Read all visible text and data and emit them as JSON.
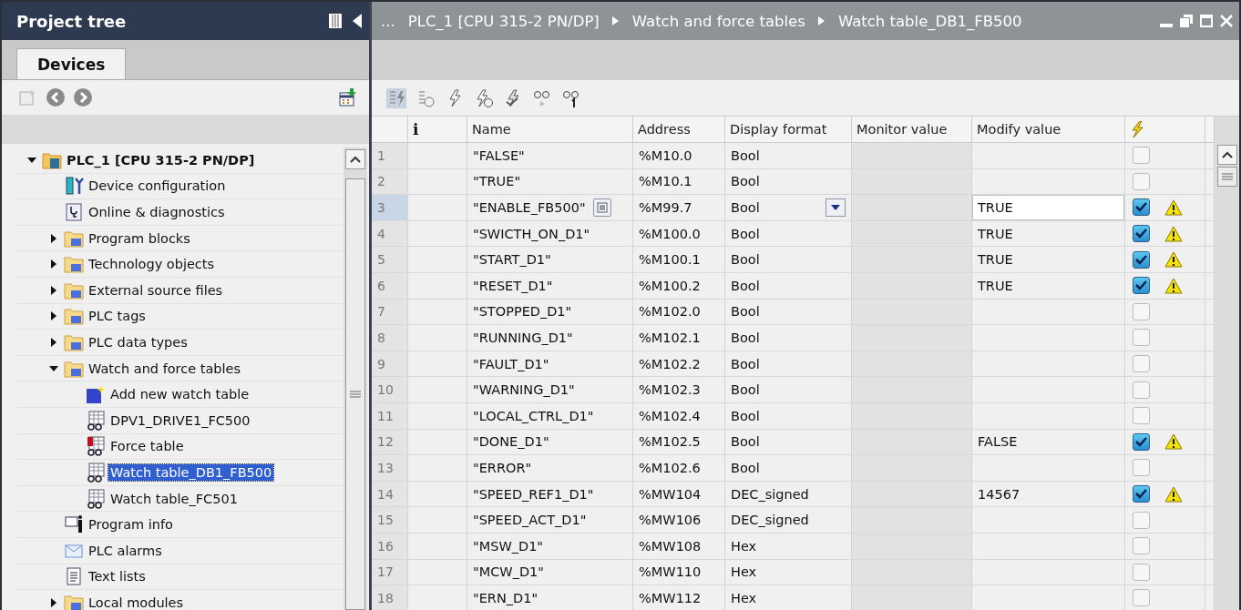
{
  "project_tree": {
    "title": "Project tree",
    "tabs": [
      {
        "label": "Devices",
        "selected": true
      }
    ],
    "items": [
      {
        "label": "PLC_1 [CPU 315-2 PN/DP]",
        "kind": "plc",
        "expanded": true,
        "selected": false,
        "children": [
          {
            "label": "Device configuration",
            "kind": "config",
            "selected": false
          },
          {
            "label": "Online & diagnostics",
            "kind": "diag",
            "selected": false
          },
          {
            "label": "Program blocks",
            "kind": "folder",
            "expanded": false,
            "selected": false
          },
          {
            "label": "Technology objects",
            "kind": "folder",
            "expanded": false,
            "selected": false
          },
          {
            "label": "External source files",
            "kind": "folder",
            "expanded": false,
            "selected": false
          },
          {
            "label": "PLC tags",
            "kind": "folder",
            "expanded": false,
            "selected": false
          },
          {
            "label": "PLC data types",
            "kind": "folder",
            "expanded": false,
            "selected": false
          },
          {
            "label": "Watch and force tables",
            "kind": "folder",
            "expanded": true,
            "selected": false,
            "children": [
              {
                "label": "Add new watch table",
                "kind": "add",
                "selected": false
              },
              {
                "label": "DPV1_DRIVE1_FC500",
                "kind": "table",
                "selected": false
              },
              {
                "label": "Force table",
                "kind": "force",
                "selected": false
              },
              {
                "label": "Watch table_DB1_FB500",
                "kind": "table",
                "selected": true
              },
              {
                "label": "Watch table_FC501",
                "kind": "table",
                "selected": false
              }
            ]
          },
          {
            "label": "Program info",
            "kind": "info",
            "selected": false
          },
          {
            "label": "PLC alarms",
            "kind": "mail",
            "selected": false
          },
          {
            "label": "Text lists",
            "kind": "text",
            "selected": false
          },
          {
            "label": "Local modules",
            "kind": "folder",
            "expanded": false,
            "selected": false
          }
        ]
      }
    ]
  },
  "editor": {
    "breadcrumb": [
      "...",
      "PLC_1 [CPU 315-2 PN/DP]",
      "Watch and force tables",
      "Watch table_DB1_FB500"
    ],
    "info_column": "i",
    "columns": [
      "Name",
      "Address",
      "Display format",
      "Monitor value",
      "Modify value"
    ],
    "rows": [
      {
        "number": "1",
        "name": "\"FALSE\"",
        "address": "%M10.0",
        "format": "Bool",
        "modify": "",
        "checked": false,
        "warning": false,
        "selected": false
      },
      {
        "number": "2",
        "name": "\"TRUE\"",
        "address": "%M10.1",
        "format": "Bool",
        "modify": "",
        "checked": false,
        "warning": false,
        "selected": false
      },
      {
        "number": "3",
        "name": "\"ENABLE_FB500\"",
        "address": "%M99.7",
        "format": "Bool",
        "modify": "TRUE",
        "checked": true,
        "warning": true,
        "selected": true
      },
      {
        "number": "4",
        "name": "\"SWICTH_ON_D1\"",
        "address": "%M100.0",
        "format": "Bool",
        "modify": "TRUE",
        "checked": true,
        "warning": true,
        "selected": false
      },
      {
        "number": "5",
        "name": "\"START_D1\"",
        "address": "%M100.1",
        "format": "Bool",
        "modify": "TRUE",
        "checked": true,
        "warning": true,
        "selected": false
      },
      {
        "number": "6",
        "name": "\"RESET_D1\"",
        "address": "%M100.2",
        "format": "Bool",
        "modify": "TRUE",
        "checked": true,
        "warning": true,
        "selected": false
      },
      {
        "number": "7",
        "name": "\"STOPPED_D1\"",
        "address": "%M102.0",
        "format": "Bool",
        "modify": "",
        "checked": false,
        "warning": false,
        "selected": false
      },
      {
        "number": "8",
        "name": "\"RUNNING_D1\"",
        "address": "%M102.1",
        "format": "Bool",
        "modify": "",
        "checked": false,
        "warning": false,
        "selected": false
      },
      {
        "number": "9",
        "name": "\"FAULT_D1\"",
        "address": "%M102.2",
        "format": "Bool",
        "modify": "",
        "checked": false,
        "warning": false,
        "selected": false
      },
      {
        "number": "10",
        "name": "\"WARNING_D1\"",
        "address": "%M102.3",
        "format": "Bool",
        "modify": "",
        "checked": false,
        "warning": false,
        "selected": false
      },
      {
        "number": "11",
        "name": "\"LOCAL_CTRL_D1\"",
        "address": "%M102.4",
        "format": "Bool",
        "modify": "",
        "checked": false,
        "warning": false,
        "selected": false
      },
      {
        "number": "12",
        "name": "\"DONE_D1\"",
        "address": "%M102.5",
        "format": "Bool",
        "modify": "FALSE",
        "checked": true,
        "warning": true,
        "selected": false
      },
      {
        "number": "13",
        "name": "\"ERROR\"",
        "address": "%M102.6",
        "format": "Bool",
        "modify": "",
        "checked": false,
        "warning": false,
        "selected": false
      },
      {
        "number": "14",
        "name": "\"SPEED_REF1_D1\"",
        "address": "%MW104",
        "format": "DEC_signed",
        "modify": "14567",
        "checked": true,
        "warning": true,
        "selected": false
      },
      {
        "number": "15",
        "name": "\"SPEED_ACT_D1\"",
        "address": "%MW106",
        "format": "DEC_signed",
        "modify": "",
        "checked": false,
        "warning": false,
        "selected": false
      },
      {
        "number": "16",
        "name": "\"MSW_D1\"",
        "address": "%MW108",
        "format": "Hex",
        "modify": "",
        "checked": false,
        "warning": false,
        "selected": false
      },
      {
        "number": "17",
        "name": "\"MCW_D1\"",
        "address": "%MW110",
        "format": "Hex",
        "modify": "",
        "checked": false,
        "warning": false,
        "selected": false
      },
      {
        "number": "18",
        "name": "\"ERN_D1\"",
        "address": "%MW112",
        "format": "Hex",
        "modify": "",
        "checked": false,
        "warning": false,
        "selected": false
      }
    ]
  }
}
